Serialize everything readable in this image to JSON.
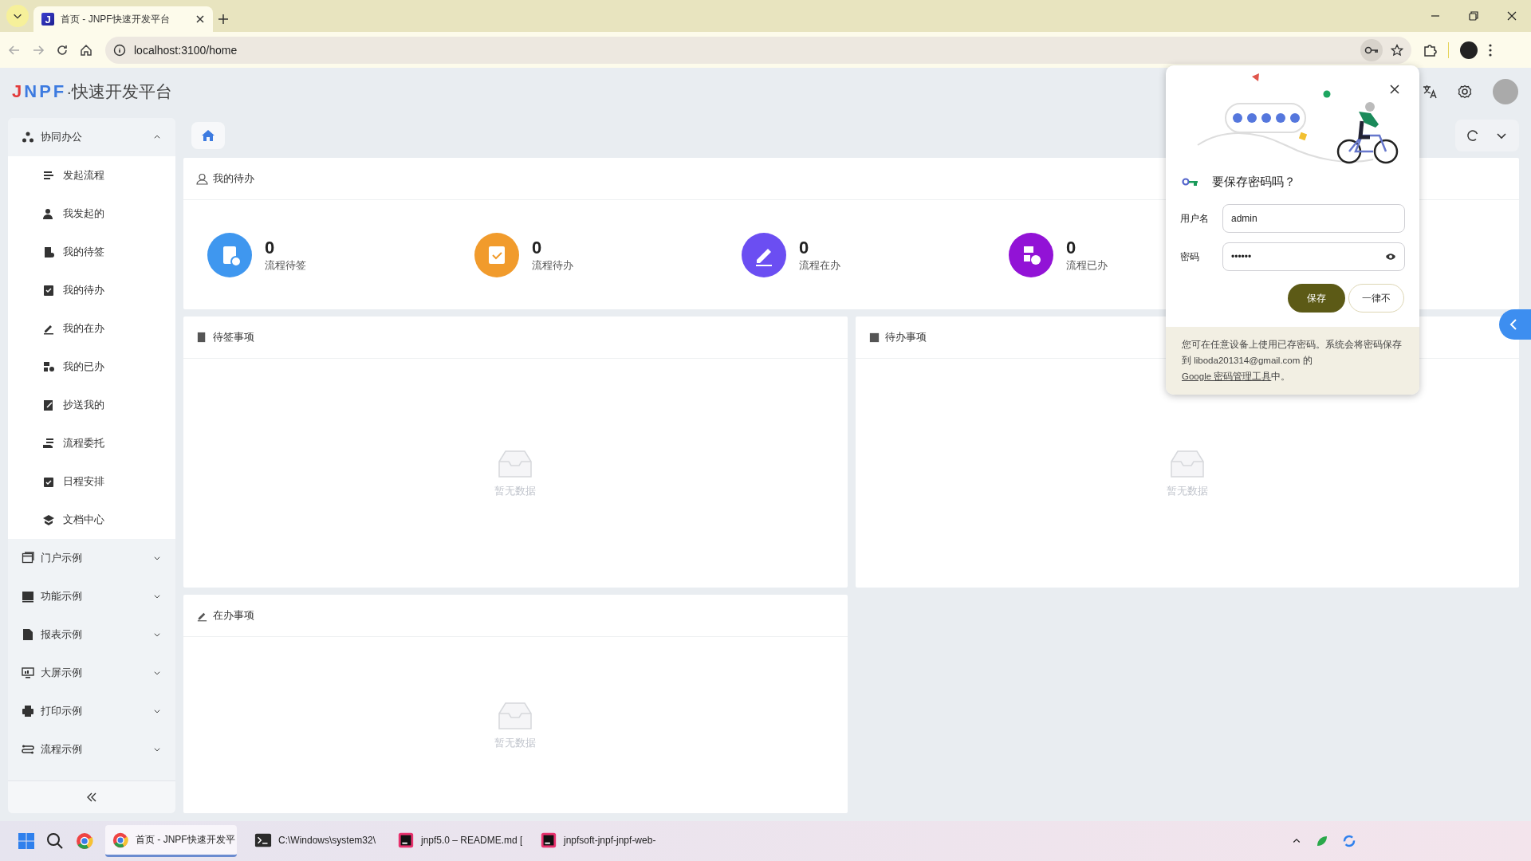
{
  "browser": {
    "favicon_letter": "J",
    "tab_title": "首页 - JNPF快速开发平台",
    "url": "localhost:3100/home"
  },
  "header": {
    "logo_mark": "JNPF",
    "logo_text": "·快速开发平台"
  },
  "sidebar": {
    "groups": [
      {
        "label": "协同办公",
        "expanded": true,
        "children": [
          {
            "label": "发起流程"
          },
          {
            "label": "我发起的"
          },
          {
            "label": "我的待签"
          },
          {
            "label": "我的待办"
          },
          {
            "label": "我的在办"
          },
          {
            "label": "我的已办"
          },
          {
            "label": "抄送我的"
          },
          {
            "label": "流程委托"
          },
          {
            "label": "日程安排"
          },
          {
            "label": "文档中心"
          }
        ]
      },
      {
        "label": "门户示例",
        "expanded": false
      },
      {
        "label": "功能示例",
        "expanded": false
      },
      {
        "label": "报表示例",
        "expanded": false
      },
      {
        "label": "大屏示例",
        "expanded": false
      },
      {
        "label": "打印示例",
        "expanded": false
      },
      {
        "label": "流程示例",
        "expanded": false
      }
    ]
  },
  "dashboard": {
    "title": "我的待办",
    "stats": [
      {
        "value": "0",
        "label": "流程待签",
        "color": "#3f97ef"
      },
      {
        "value": "0",
        "label": "流程待办",
        "color": "#f19b2c"
      },
      {
        "value": "0",
        "label": "流程在办",
        "color": "#6b4ef2"
      },
      {
        "value": "0",
        "label": "流程已办",
        "color": "#9213d6"
      }
    ]
  },
  "panels": [
    {
      "title": "待签事项",
      "empty_text": "暂无数据"
    },
    {
      "title": "待办事项",
      "empty_text": "暂无数据"
    },
    {
      "title": "在办事项",
      "empty_text": "暂无数据"
    }
  ],
  "password_prompt": {
    "title": "要保存密码吗？",
    "username_label": "用户名",
    "username": "admin",
    "password_label": "密码",
    "password": "••••••",
    "save": "保存",
    "never": "一律不",
    "footer": "您可在任意设备上使用已存密码。系统会将密码保存到 liboda201314@gmail.com 的 ",
    "footer_link": "Google 密码管理工具",
    "footer_end": "中。"
  },
  "taskbar": {
    "apps": [
      {
        "label": "首页 - JNPF快速开发平",
        "kind": "chrome",
        "active": true
      },
      {
        "label": "C:\\Windows\\system32\\",
        "kind": "terminal",
        "active": false
      },
      {
        "label": "jnpf5.0 – README.md [",
        "kind": "ide",
        "active": false
      },
      {
        "label": "jnpfsoft-jnpf-jnpf-web-",
        "kind": "ide",
        "active": false
      }
    ]
  }
}
